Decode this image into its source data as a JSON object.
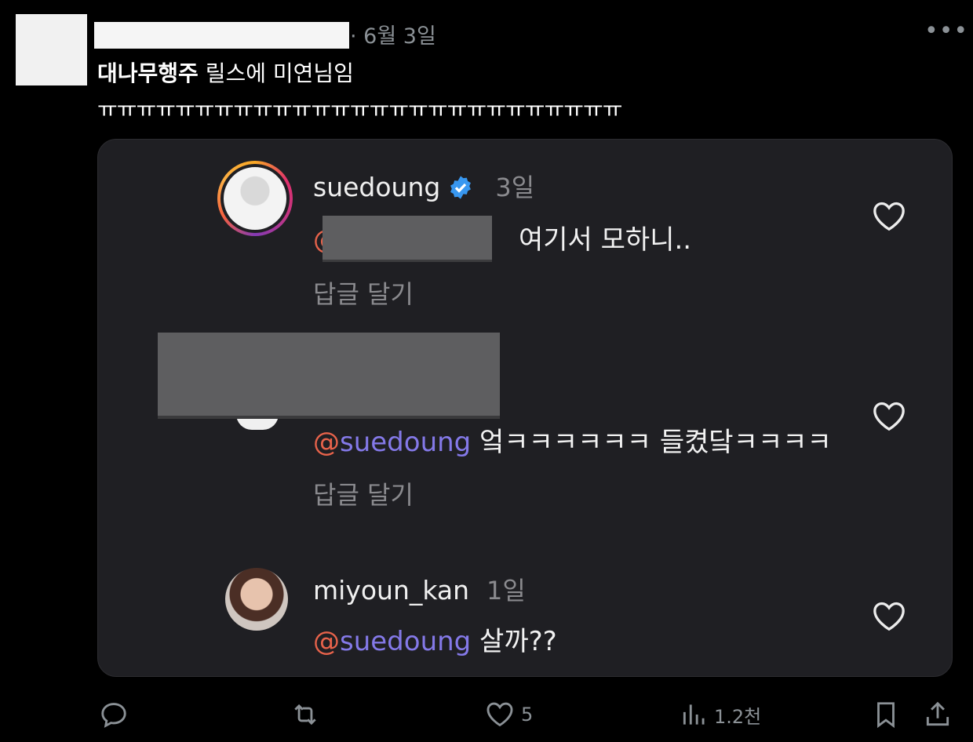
{
  "tweet": {
    "date": "· 6월 3일",
    "more": "•••",
    "text_bold": "대나무행주",
    "text_rest": " 릴스에 미연님임",
    "text_line2": "ㅠㅠㅠㅠㅠㅠㅠㅠㅠㅠㅠㅠㅠㅠㅠㅠㅠㅠㅠㅠㅠㅠㅠㅠㅠㅠㅠ"
  },
  "card": {
    "comments": [
      {
        "username": "suedoung",
        "verified": true,
        "time": "3일",
        "mention_at": "@",
        "mention_name": "",
        "text": "여기서 모하니..",
        "reply": "답글 달기"
      },
      {
        "username": "",
        "verified": false,
        "time": "",
        "mention_at": "@",
        "mention_name": "suedoung",
        "text": " 엌ㅋㅋㅋㅋㅋㅋ 들켰닼ㅋㅋㅋㅋ",
        "reply": "답글 달기"
      },
      {
        "username": "miyoun_kan",
        "verified": false,
        "time": "1일",
        "mention_at": "@",
        "mention_name": "suedoung",
        "text": " 살까??",
        "reply": ""
      }
    ]
  },
  "actions": {
    "reply_count": "",
    "retweet_count": "",
    "like_count": "5",
    "views_count": "1.2천"
  },
  "colors": {
    "mention_at": "#e8634b",
    "mention_name": "#8479e8",
    "verified": "#3897f0"
  }
}
